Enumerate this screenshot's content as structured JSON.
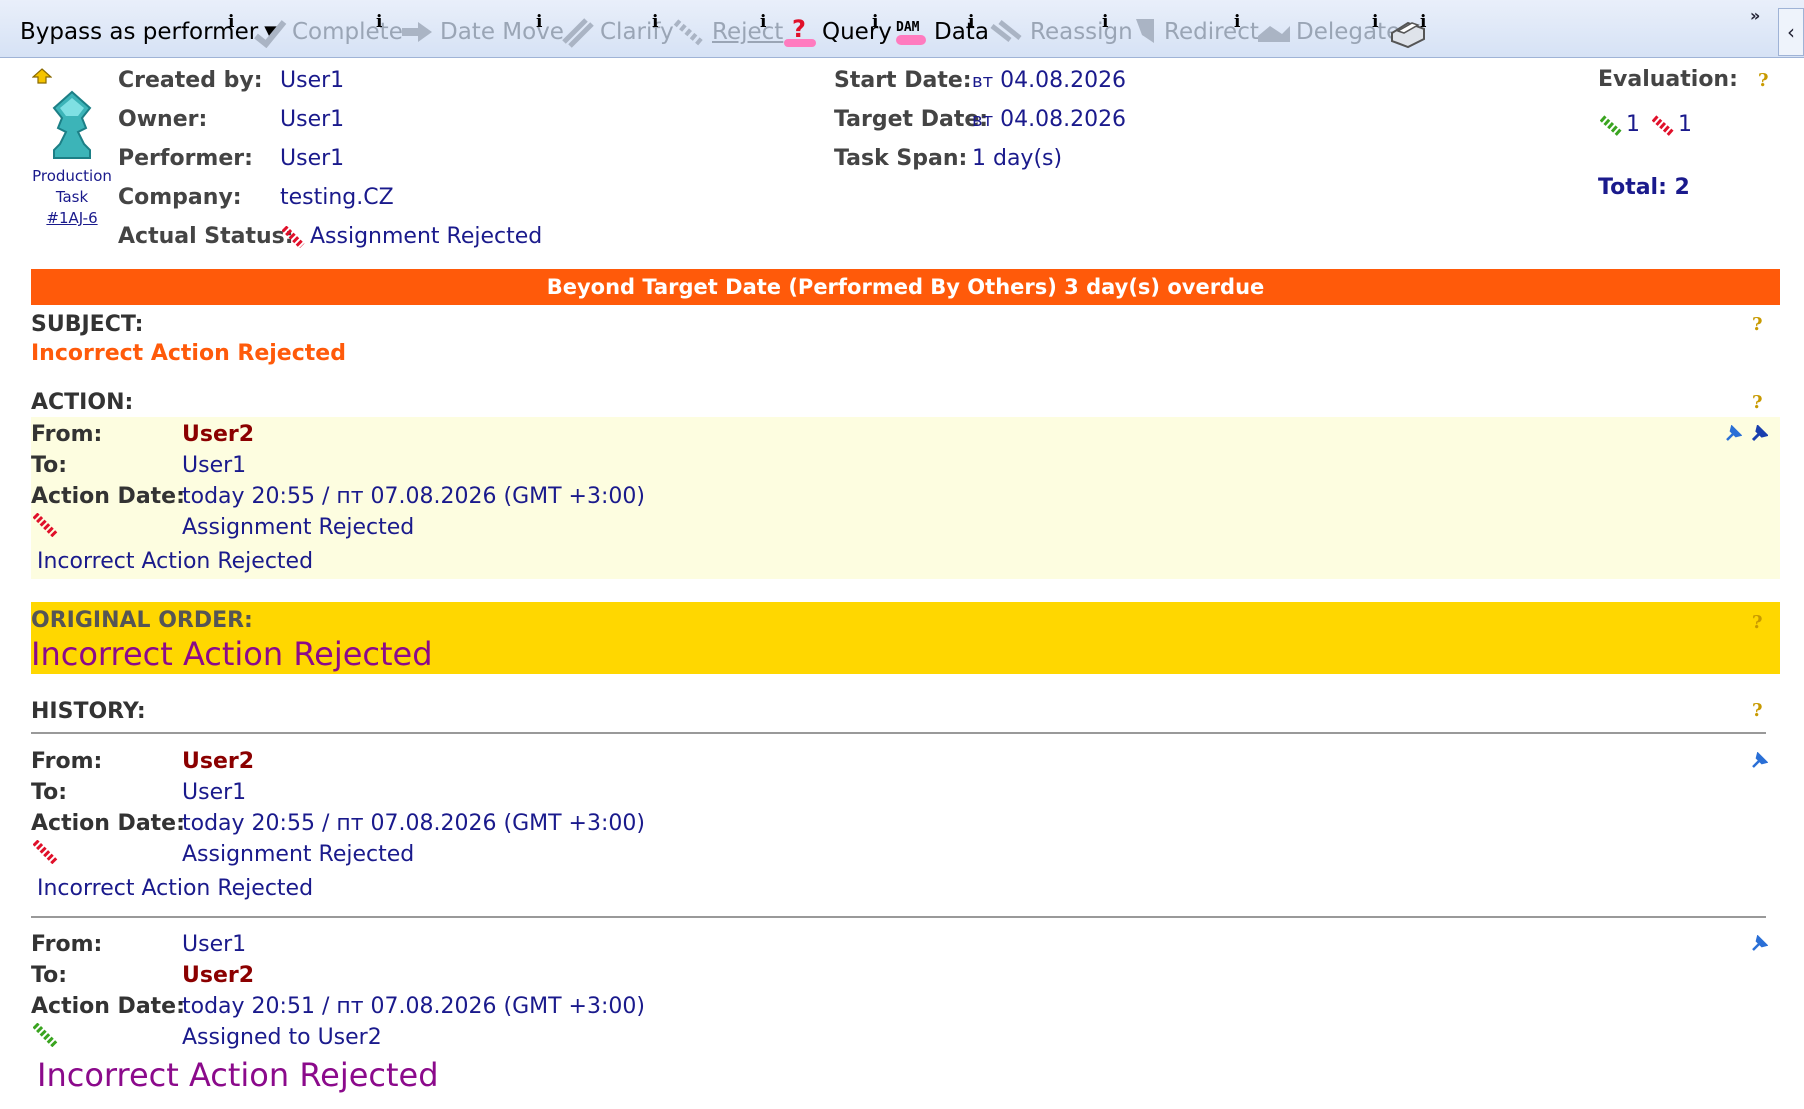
{
  "toolbar": {
    "bypass": "Bypass as performer",
    "complete": "Complete",
    "date_move": "Date Move",
    "clarify": "Clarify",
    "reject": "Reject",
    "query": "Query",
    "data": "Data",
    "reassign": "Reassign",
    "redirect": "Redirect",
    "delegate": "Delegate",
    "info_glyph": "i",
    "more_glyph": "»",
    "collapse_glyph": "‹"
  },
  "task": {
    "type_line1": "Production",
    "type_line2": "Task",
    "id": "#1AJ-6"
  },
  "header": {
    "created_by_label": "Created by:",
    "created_by": "User1",
    "owner_label": "Owner:",
    "owner": "User1",
    "performer_label": "Performer:",
    "performer": "User1",
    "company_label": "Company:",
    "company": "testing.CZ",
    "actual_status_label": "Actual Status:",
    "actual_status": "Assignment Rejected",
    "start_date_label": "Start Date:",
    "start_date_day": "вт",
    "start_date": "04.08.2026",
    "target_date_label": "Target Date:",
    "target_date_day": "вт",
    "target_date": "04.08.2026",
    "task_span_label": "Task Span:",
    "task_span": "1 day(s)",
    "evaluation_label": "Evaluation:",
    "evaluation_positive": "1",
    "evaluation_negative": "1",
    "total": "Total: 2"
  },
  "overdue_banner": "Beyond Target Date (Performed By Others) 3 day(s) overdue",
  "subject": {
    "title": "SUBJECT:",
    "text": "Incorrect Action Rejected"
  },
  "action": {
    "title": "ACTION:",
    "from_label": "From:",
    "from": "User2",
    "to_label": "To:",
    "to": "User1",
    "date_label": "Action Date:",
    "date": "today 20:55 / пт 07.08.2026 (GMT +3:00)",
    "status": "Assignment Rejected",
    "note": "Incorrect Action Rejected"
  },
  "original_order": {
    "title": "ORIGINAL ORDER:",
    "text": "Incorrect Action Rejected"
  },
  "history": {
    "title": "HISTORY:",
    "entries": [
      {
        "from_label": "From:",
        "from": "User2",
        "to_label": "To:",
        "to": "User1",
        "date_label": "Action Date:",
        "date": "today 20:55 / пт 07.08.2026 (GMT +3:00)",
        "status": "Assignment Rejected",
        "note": "Incorrect Action Rejected"
      },
      {
        "from_label": "From:",
        "from": "User1",
        "to_label": "To:",
        "to": "User2",
        "date_label": "Action Date:",
        "date": "today 20:51 / пт 07.08.2026 (GMT +3:00)",
        "status": "Assigned to User2",
        "note": "Incorrect Action Rejected"
      }
    ]
  },
  "help_glyph": "?",
  "colors": {
    "overdue": "#ff5a0a",
    "original_order": "#ffd700",
    "action_bg": "#fdfde0",
    "link": "#1a1a8c"
  }
}
